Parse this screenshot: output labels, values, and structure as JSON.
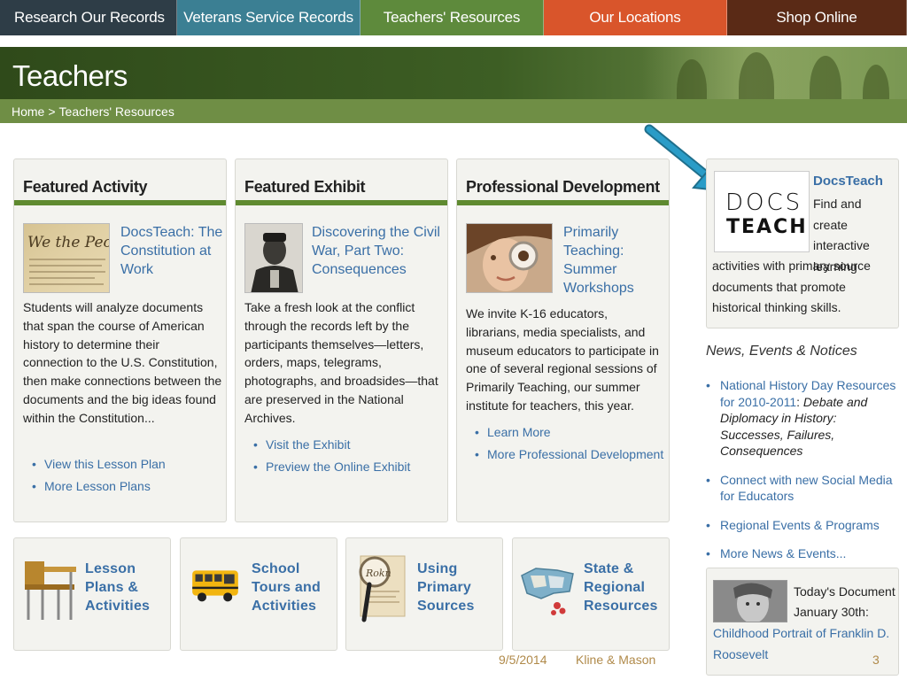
{
  "nav": {
    "tabs": [
      {
        "label": "Research Our Records",
        "color": "#2e3d47"
      },
      {
        "label": "Veterans Service Records",
        "color": "#3b7f93"
      },
      {
        "label": "Teachers' Resources",
        "color": "#5e8a3c"
      },
      {
        "label": "Our Locations",
        "color": "#d9552b"
      },
      {
        "label": "Shop Online",
        "color": "#5a2a16"
      }
    ]
  },
  "banner": {
    "title": "Teachers",
    "breadcrumb": {
      "home": "Home",
      "separator": ">",
      "current": "Teachers' Resources"
    }
  },
  "cards": [
    {
      "title": "Featured Activity",
      "image_icon": "constitution-document-icon",
      "link": "DocsTeach: The Constitution at Work",
      "body": "Students will analyze documents that span the course of American history to determine their connection to the U.S. Constitution, then make connections between the documents and the big ideas found within the Constitution...",
      "links": [
        "View this Lesson Plan",
        "More Lesson Plans"
      ]
    },
    {
      "title": "Featured Exhibit",
      "image_icon": "civil-war-soldier-portrait",
      "link": "Discovering the Civil War, Part Two: Consequences",
      "body": "Take a fresh look at the conflict through the records left by the participants themselves—letters, orders, maps, telegrams, photographs, and broadsides—that are preserved in the National Archives.",
      "links": [
        "Visit the Exhibit",
        "Preview the Online Exhibit"
      ]
    },
    {
      "title": "Professional Development",
      "image_icon": "girl-with-magnifying-glass",
      "link": "Primarily Teaching: Summer Workshops",
      "body": "We invite K-16 educators, librarians, media specialists, and museum educators to participate in one of several regional sessions of Primarily Teaching, our summer institute for teachers, this year.",
      "links": [
        "Learn More",
        "More Professional Development"
      ]
    }
  ],
  "docsteach": {
    "logo_line1": "DOCS",
    "logo_line2": "TEACH",
    "name": "DocsTeach",
    "desc_a": "Find and create interactive learning",
    "desc_b": "activities with primary source documents that promote historical thinking skills."
  },
  "news": {
    "title": "News, Events & Notices",
    "items": [
      {
        "link": "National History Day Resources for 2010-2011",
        "sep": ": ",
        "italic": "Debate and Diplomacy in History: Successes, Failures, Consequences"
      },
      {
        "link": "Connect with new Social Media for Educators"
      },
      {
        "link": "Regional Events & Programs"
      },
      {
        "link": "More News & Events..."
      }
    ]
  },
  "todays_document": {
    "label_line1": "Today's Document",
    "label_line2": "January 30th:",
    "link": "Childhood Portrait of Franklin D. Roosevelt"
  },
  "tiles": [
    {
      "label_lines": [
        "Lesson",
        "Plans &",
        "Activities"
      ],
      "icon": "school-desk-icon"
    },
    {
      "label_lines": [
        "School",
        "Tours and",
        "Activities"
      ],
      "icon": "school-bus-icon"
    },
    {
      "label_lines": [
        "Using",
        "Primary",
        "Sources"
      ],
      "icon": "magnifier-document-icon"
    },
    {
      "label_lines": [
        "State &",
        "Regional",
        "Resources"
      ],
      "icon": "us-map-icon"
    }
  ],
  "footer": {
    "date": "9/5/2014",
    "authors": "Kline & Mason",
    "page": "3"
  },
  "colors": {
    "accent_green": "#5f8a30",
    "link_blue": "#3a6fa6",
    "arrow": "#2a8fb5"
  }
}
